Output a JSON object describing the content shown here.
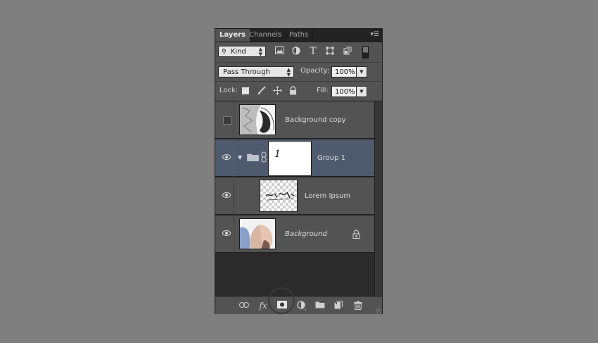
{
  "tabs": [
    {
      "label": "Layers",
      "active": true
    },
    {
      "label": "Channels",
      "active": false
    },
    {
      "label": "Paths",
      "active": false
    }
  ],
  "filter": {
    "kind_label": "Kind",
    "icons": [
      "image-filter-icon",
      "adjustment-filter-icon",
      "type-filter-icon",
      "shape-filter-icon",
      "smart-object-filter-icon",
      "filter-toggle-icon"
    ],
    "type_glyph": "T"
  },
  "blend": {
    "mode": "Pass Through",
    "opacity_label": "Opacity:",
    "opacity_value": "100%"
  },
  "lock": {
    "label": "Lock:",
    "fill_label": "Fill:",
    "fill_value": "100%"
  },
  "layers": [
    {
      "name": "Background copy",
      "visible": false,
      "selected": false
    },
    {
      "name": "Group 1",
      "visible": true,
      "selected": true,
      "group_glyph": "1"
    },
    {
      "name": "Lorem Ipsum",
      "visible": true,
      "selected": false
    },
    {
      "name": "Background",
      "visible": true,
      "selected": false,
      "locked": true
    }
  ],
  "bottom_icons": [
    "link-layers-icon",
    "fx-icon",
    "add-mask-icon",
    "new-adjustment-icon",
    "new-group-icon",
    "new-layer-icon",
    "delete-icon"
  ],
  "fx_label": "fx",
  "colors": {
    "selected_row": "#4f5a6e",
    "panel": "#535353",
    "background": "#7f7f7f"
  }
}
